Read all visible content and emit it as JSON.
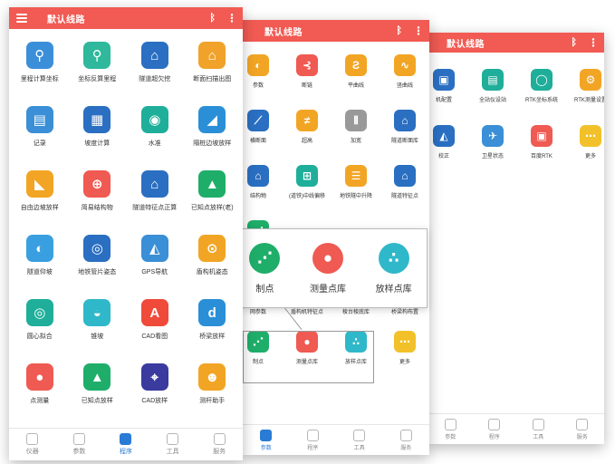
{
  "panel1": {
    "title": "默认线路",
    "icons": {
      "menu": "menu-icon",
      "bluetooth": "bluetooth-icon",
      "more": "more-vert-icon"
    },
    "items": [
      {
        "label": "里程计算坐标",
        "glyph": "⚲",
        "color": "#3b8fd9",
        "icon": "route-coord-icon"
      },
      {
        "label": "坐标反算里程",
        "glyph": "⚲",
        "color": "#2fb89c",
        "icon": "reverse-coord-icon"
      },
      {
        "label": "隧道超欠挖",
        "glyph": "⌂",
        "color": "#2a6fc1",
        "icon": "tunnel-icon"
      },
      {
        "label": "断面扫描出图",
        "glyph": "⌂",
        "color": "#f0a22a",
        "icon": "section-scan-icon"
      },
      {
        "label": "记录",
        "glyph": "▤",
        "color": "#3a8fd6",
        "icon": "record-icon"
      },
      {
        "label": "坡度计算",
        "glyph": "▦",
        "color": "#2a6fc1",
        "icon": "slope-calc-icon"
      },
      {
        "label": "水准",
        "glyph": "◉",
        "color": "#1fae9a",
        "icon": "level-icon"
      },
      {
        "label": "隔桩边坡放样",
        "glyph": "◢",
        "color": "#2a8fd6",
        "icon": "slope-stakeout-icon"
      },
      {
        "label": "自由边坡放样",
        "glyph": "◣",
        "color": "#f2a524",
        "icon": "free-slope-icon"
      },
      {
        "label": "简易结构物",
        "glyph": "⊕",
        "color": "#ef5a52",
        "icon": "structure-icon"
      },
      {
        "label": "隧道特征点正算",
        "glyph": "⌂",
        "color": "#2a6fc1",
        "icon": "tunnel-feature-icon"
      },
      {
        "label": "已知点放样(老)",
        "glyph": "▲",
        "color": "#1fae6a",
        "icon": "known-point-old-icon"
      },
      {
        "label": "隧道仰坡",
        "glyph": "◐",
        "color": "#3a9fe0",
        "icon": "tunnel-slope-icon"
      },
      {
        "label": "地铁管片姿态",
        "glyph": "◎",
        "color": "#2a6fc1",
        "icon": "subway-segment-icon"
      },
      {
        "label": "GPS导航",
        "glyph": "◭",
        "color": "#3a8fd6",
        "icon": "gps-nav-icon"
      },
      {
        "label": "盾构机姿态",
        "glyph": "⊙",
        "color": "#f2a524",
        "icon": "shield-machine-icon"
      },
      {
        "label": "圆心拟合",
        "glyph": "◎",
        "color": "#1fae9a",
        "icon": "circle-fit-icon"
      },
      {
        "label": "锥坡",
        "glyph": "◒",
        "color": "#2fb8c9",
        "icon": "cone-slope-icon"
      },
      {
        "label": "CAD看图",
        "glyph": "A",
        "color": "#ef4a3a",
        "icon": "cad-view-icon"
      },
      {
        "label": "桥梁放样",
        "glyph": "d",
        "color": "#2a8fd6",
        "icon": "bridge-icon"
      },
      {
        "label": "点测量",
        "glyph": "●",
        "color": "#ef5a52",
        "icon": "point-measure-icon"
      },
      {
        "label": "已知点放样",
        "glyph": "▲",
        "color": "#1fae6a",
        "icon": "known-point-icon"
      },
      {
        "label": "CAD放样",
        "glyph": "⌖",
        "color": "#3a3a9f",
        "icon": "cad-stakeout-icon"
      },
      {
        "label": "测杆助手",
        "glyph": "☻",
        "color": "#f2a524",
        "icon": "pole-helper-icon"
      },
      {
        "label": "",
        "glyph": "⋯",
        "color": "#f2c12a",
        "icon": "more-apps-icon"
      }
    ],
    "tabs": [
      {
        "label": "仪器",
        "icon": "instrument-tab-icon",
        "active": false
      },
      {
        "label": "参数",
        "icon": "params-tab-icon",
        "active": false
      },
      {
        "label": "程序",
        "icon": "program-tab-icon",
        "active": true
      },
      {
        "label": "工具",
        "icon": "tools-tab-icon",
        "active": false
      },
      {
        "label": "服务",
        "icon": "service-tab-icon",
        "active": false
      }
    ]
  },
  "panel2": {
    "title": "默认线路",
    "items": [
      {
        "label": "参数",
        "glyph": "◐",
        "color": "#f2a524"
      },
      {
        "label": "断链",
        "glyph": "⊰",
        "color": "#ef5a52"
      },
      {
        "label": "平曲线",
        "glyph": "Ƨ",
        "color": "#f2a524"
      },
      {
        "label": "竖曲线",
        "glyph": "∿",
        "color": "#f2a524"
      },
      {
        "label": "横断面",
        "glyph": "⟋",
        "color": "#2a6fc1"
      },
      {
        "label": "超高",
        "glyph": "≠",
        "color": "#f2a524"
      },
      {
        "label": "加宽",
        "glyph": "⫴",
        "color": "#999999"
      },
      {
        "label": "隧道断面库",
        "glyph": "⌂",
        "color": "#2a6fc1"
      },
      {
        "label": "结构物",
        "glyph": "⌂",
        "color": "#2a6fc1"
      },
      {
        "label": "(道铁)中线偏移",
        "glyph": "⊞",
        "color": "#1fae9a"
      },
      {
        "label": "地铁隧中升降",
        "glyph": "☰",
        "color": "#f2a524"
      },
      {
        "label": "隧道特征点",
        "glyph": "⌂",
        "color": "#2a6fc1"
      },
      {
        "label": "控制点",
        "glyph": "⋰",
        "color": "#1fae6a"
      },
      {
        "label": "",
        "glyph": "",
        "color": "#ffffff"
      },
      {
        "label": "",
        "glyph": "",
        "color": "#ffffff"
      },
      {
        "label": "",
        "glyph": "",
        "color": "#ffffff"
      },
      {
        "label": "网参数",
        "glyph": "",
        "color": "#ffffff"
      },
      {
        "label": "盾构机特征点",
        "glyph": "",
        "color": "#ffffff"
      },
      {
        "label": "棱台棱底库",
        "glyph": "",
        "color": "#ffffff"
      },
      {
        "label": "桥梁构布置",
        "glyph": "",
        "color": "#ffffff"
      },
      {
        "label": "制点",
        "glyph": "⋰",
        "color": "#1fae6a"
      },
      {
        "label": "测量点库",
        "glyph": "●",
        "color": "#ef5a52"
      },
      {
        "label": "放样点库",
        "glyph": "∴",
        "color": "#2fb8c9"
      },
      {
        "label": "更多",
        "glyph": "⋯",
        "color": "#f2c12a"
      }
    ],
    "zoom": [
      {
        "label": "制点",
        "glyph": "⋰",
        "color": "#1fae6a"
      },
      {
        "label": "测量点库",
        "glyph": "●",
        "color": "#ef5a52"
      },
      {
        "label": "放样点库",
        "glyph": "∴",
        "color": "#2fb8c9"
      }
    ],
    "tabs": [
      {
        "label": "参数",
        "icon": "params-tab-icon",
        "active": true
      },
      {
        "label": "程序",
        "icon": "program-tab-icon",
        "active": false
      },
      {
        "label": "工具",
        "icon": "tools-tab-icon",
        "active": false
      },
      {
        "label": "服务",
        "icon": "service-tab-icon",
        "active": false
      }
    ]
  },
  "panel3": {
    "title": "默认线路",
    "items": [
      {
        "label": "机配置",
        "glyph": "▣",
        "color": "#2a6fc1"
      },
      {
        "label": "全站仪设站",
        "glyph": "▤",
        "color": "#1fae9a"
      },
      {
        "label": "RTK坐标系统",
        "glyph": "◯",
        "color": "#1fae9a"
      },
      {
        "label": "RTK测量设置",
        "glyph": "⚙",
        "color": "#f2a524"
      },
      {
        "label": "校正",
        "glyph": "◭",
        "color": "#2a6fc1"
      },
      {
        "label": "卫星状态",
        "glyph": "✈",
        "color": "#3a8fd6"
      },
      {
        "label": "百度RTK",
        "glyph": "▣",
        "color": "#ef5a52"
      },
      {
        "label": "更多",
        "glyph": "⋯",
        "color": "#f2c12a"
      }
    ],
    "tabs": [
      {
        "label": "参数",
        "icon": "params-tab-icon",
        "active": false
      },
      {
        "label": "程序",
        "icon": "program-tab-icon",
        "active": false
      },
      {
        "label": "工具",
        "icon": "tools-tab-icon",
        "active": false
      },
      {
        "label": "服务",
        "icon": "service-tab-icon",
        "active": false
      }
    ]
  }
}
